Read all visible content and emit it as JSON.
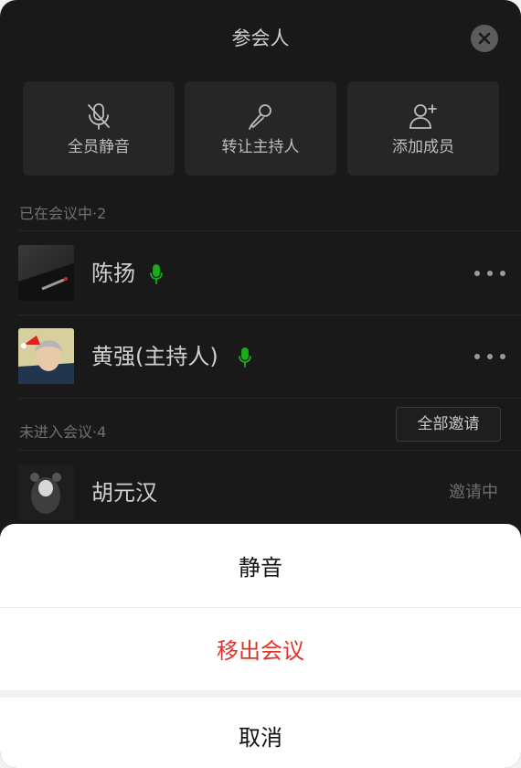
{
  "header": {
    "title": "参会人",
    "close_icon": "close-icon"
  },
  "actions": [
    {
      "label": "全员静音",
      "icon": "mic-off-icon"
    },
    {
      "label": "转让主持人",
      "icon": "microphone-icon"
    },
    {
      "label": "添加成员",
      "icon": "add-user-icon"
    }
  ],
  "in_meeting": {
    "label": "已在会议中·2",
    "participants": [
      {
        "name": "陈扬",
        "mic": "mic-on-icon"
      },
      {
        "name": "黄强(主持人)",
        "mic": "mic-on-icon"
      }
    ]
  },
  "not_joined": {
    "label": "未进入会议·4",
    "invite_all_label": "全部邀请",
    "participants": [
      {
        "name": "胡元汉",
        "status": "邀请中"
      }
    ]
  },
  "action_sheet": {
    "items": [
      {
        "label": "静音",
        "color": "#111111"
      },
      {
        "label": "移出会议",
        "color": "#e0342b"
      }
    ],
    "cancel_label": "取消"
  },
  "colors": {
    "background": "#191919",
    "tile": "#262626",
    "mic_green": "#1aad19",
    "danger": "#e0342b"
  }
}
